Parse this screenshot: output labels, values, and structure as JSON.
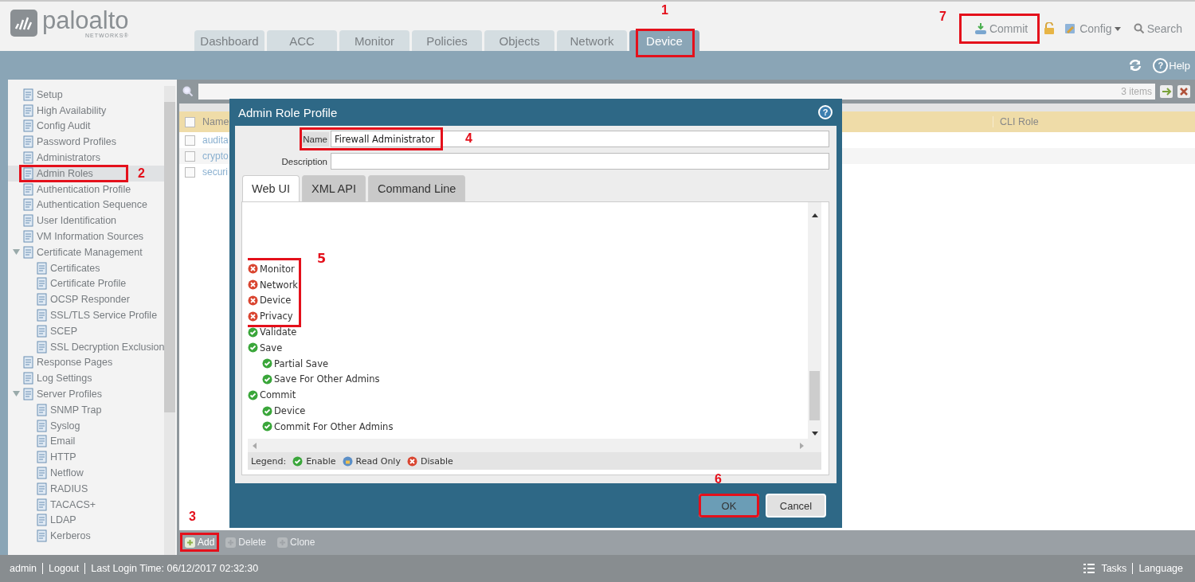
{
  "logo": {
    "name": "paloalto",
    "tagline": "NETWORKS®"
  },
  "tabs": [
    {
      "label": "Dashboard",
      "selected": false
    },
    {
      "label": "ACC",
      "selected": false
    },
    {
      "label": "Monitor",
      "selected": false
    },
    {
      "label": "Policies",
      "selected": false
    },
    {
      "label": "Objects",
      "selected": false
    },
    {
      "label": "Network",
      "selected": false
    },
    {
      "label": "Device",
      "selected": true,
      "marker": "1"
    }
  ],
  "header_actions": {
    "commit": {
      "label": "Commit",
      "marker": "7"
    },
    "config": "Config",
    "search": "Search"
  },
  "help": "Help",
  "help_glyph": "?",
  "sidebar": {
    "items": [
      {
        "label": "Setup",
        "selected": false
      },
      {
        "label": "High Availability",
        "selected": false
      },
      {
        "label": "Config Audit",
        "selected": false
      },
      {
        "label": "Password Profiles",
        "selected": false
      },
      {
        "label": "Administrators",
        "selected": false
      },
      {
        "label": "Admin Roles",
        "selected": true,
        "marker": "2"
      },
      {
        "label": "Authentication Profile",
        "selected": false
      },
      {
        "label": "Authentication Sequence",
        "selected": false
      },
      {
        "label": "User Identification",
        "selected": false
      },
      {
        "label": "VM Information Sources",
        "selected": false
      },
      {
        "label": "Certificate Management",
        "selected": false,
        "expanded": true,
        "children": [
          {
            "label": "Certificates",
            "selected": false
          },
          {
            "label": "Certificate Profile",
            "selected": false
          },
          {
            "label": "OCSP Responder",
            "selected": false
          },
          {
            "label": "SSL/TLS Service Profile",
            "selected": false
          },
          {
            "label": "SCEP",
            "selected": false
          },
          {
            "label": "SSL Decryption Exclusion",
            "selected": false
          }
        ]
      },
      {
        "label": "Response Pages",
        "selected": false
      },
      {
        "label": "Log Settings",
        "selected": false
      },
      {
        "label": "Server Profiles",
        "selected": false,
        "expanded": true,
        "children": [
          {
            "label": "SNMP Trap",
            "selected": false
          },
          {
            "label": "Syslog",
            "selected": false
          },
          {
            "label": "Email",
            "selected": false
          },
          {
            "label": "HTTP",
            "selected": false
          },
          {
            "label": "Netflow",
            "selected": false
          },
          {
            "label": "RADIUS",
            "selected": false
          },
          {
            "label": "TACACS+",
            "selected": false
          },
          {
            "label": "LDAP",
            "selected": false
          },
          {
            "label": "Kerberos",
            "selected": false
          }
        ]
      }
    ]
  },
  "table": {
    "count": "3 items",
    "columns": [
      "Name",
      "CLI Role"
    ],
    "select_all": {
      "checked": false
    },
    "rows": [
      {
        "name": "audita",
        "checked": false
      },
      {
        "name": "crypto",
        "checked": false
      },
      {
        "name": "securi",
        "checked": false
      }
    ],
    "toolbar": [
      {
        "label": "Add",
        "disabled": false,
        "marker": "3"
      },
      {
        "label": "Delete",
        "disabled": true
      },
      {
        "label": "Clone",
        "disabled": true
      }
    ]
  },
  "dialog": {
    "title": "Admin Role Profile",
    "help_glyph": "?",
    "name_field": {
      "label": "Name",
      "value": "Firewall Administrator",
      "marker": "4"
    },
    "description_field": {
      "label": "Description"
    },
    "tabs": [
      {
        "label": "Web UI",
        "selected": true
      },
      {
        "label": "XML API",
        "selected": false
      },
      {
        "label": "Command Line",
        "selected": false
      }
    ],
    "permissions": {
      "flagged": {
        "marker": "5",
        "items": [
          {
            "label": "Monitor",
            "kind": "disable"
          },
          {
            "label": "Network",
            "kind": "disable"
          },
          {
            "label": "Device",
            "kind": "disable"
          },
          {
            "label": "Privacy",
            "kind": "disable"
          }
        ]
      },
      "items": [
        {
          "label": "Validate",
          "kind": "enable"
        },
        {
          "label": "Save",
          "kind": "enable",
          "children": [
            {
              "label": "Partial Save",
              "kind": "enable"
            },
            {
              "label": "Save For Other Admins",
              "kind": "enable"
            }
          ]
        },
        {
          "label": "Commit",
          "kind": "enable",
          "children": [
            {
              "label": "Device",
              "kind": "enable"
            },
            {
              "label": "Commit For Other Admins",
              "kind": "enable"
            }
          ]
        }
      ]
    },
    "legend": {
      "label": "Legend:",
      "entries": [
        {
          "kind": "enable",
          "label": "Enable"
        },
        {
          "kind": "read_only",
          "label": "Read Only"
        },
        {
          "kind": "disable",
          "label": "Disable"
        }
      ]
    },
    "buttons": [
      {
        "label": "OK",
        "kind": "primary",
        "marker": "6"
      },
      {
        "label": "Cancel",
        "kind": "secondary"
      }
    ]
  },
  "footer": {
    "user": "admin",
    "logout": "Logout",
    "last_login": "Last Login Time: 06/12/2017 02:32:30",
    "tasks": "Tasks",
    "language": "Language"
  }
}
